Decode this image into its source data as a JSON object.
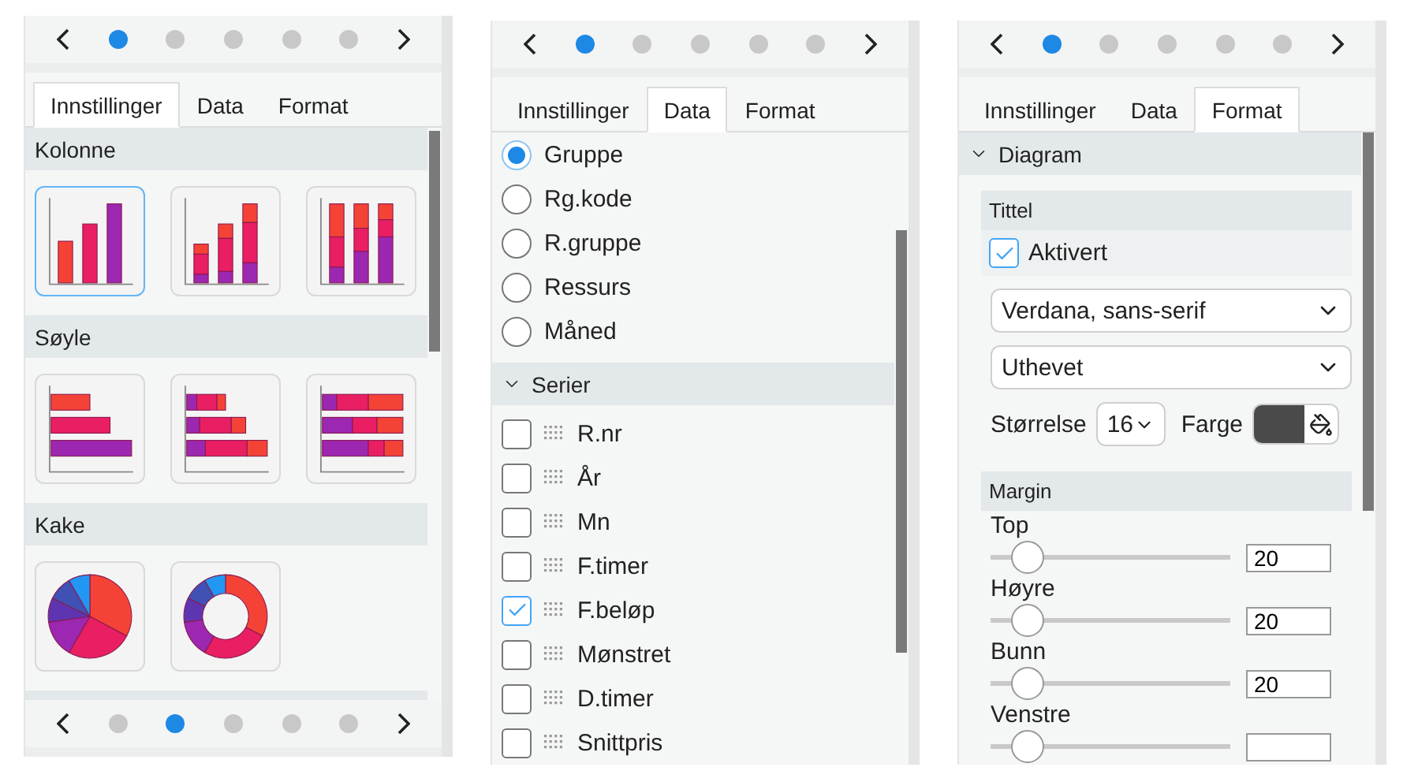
{
  "panels": [
    {
      "kind": "chart-types",
      "pager": [
        {
          "selected": true
        },
        {
          "selected": false
        },
        {
          "selected": false
        },
        {
          "selected": false
        },
        {
          "selected": false
        }
      ],
      "tabs": [
        {
          "label": "Innstillinger",
          "selected": true
        },
        {
          "label": "Data",
          "selected": false
        },
        {
          "label": "Format",
          "selected": false
        }
      ],
      "sections": [
        {
          "title": "Kolonne",
          "charts": [
            {
              "kind": "column",
              "selected": true
            },
            {
              "kind": "column-stacked",
              "selected": false
            },
            {
              "kind": "column-full",
              "selected": false
            }
          ]
        },
        {
          "title": "Søyle",
          "charts": [
            {
              "kind": "bar",
              "selected": false
            },
            {
              "kind": "bar-stacked",
              "selected": false
            },
            {
              "kind": "bar-full",
              "selected": false
            }
          ]
        },
        {
          "title": "Kake",
          "charts": [
            {
              "kind": "pie",
              "selected": false
            },
            {
              "kind": "donut",
              "selected": false
            }
          ]
        }
      ],
      "bottom_pager": [
        {
          "selected": false
        },
        {
          "selected": true
        },
        {
          "selected": false
        },
        {
          "selected": false
        },
        {
          "selected": false
        }
      ]
    },
    {
      "kind": "data",
      "pager": [
        {
          "selected": true
        },
        {
          "selected": false
        },
        {
          "selected": false
        },
        {
          "selected": false
        },
        {
          "selected": false
        }
      ],
      "tabs": [
        {
          "label": "Innstillinger",
          "selected": false
        },
        {
          "label": "Data",
          "selected": true
        },
        {
          "label": "Format",
          "selected": false
        }
      ],
      "groupings": [
        {
          "label": "Gruppe",
          "selected": true
        },
        {
          "label": "Rg.kode",
          "selected": false
        },
        {
          "label": "R.gruppe",
          "selected": false
        },
        {
          "label": "Ressurs",
          "selected": false
        },
        {
          "label": "Måned",
          "selected": false
        }
      ],
      "series_section": {
        "title": "Serier",
        "expanded": true,
        "items": [
          {
            "label": "R.nr",
            "checked": false
          },
          {
            "label": "År",
            "checked": false
          },
          {
            "label": "Mn",
            "checked": false
          },
          {
            "label": "F.timer",
            "checked": false
          },
          {
            "label": "F.beløp",
            "checked": true
          },
          {
            "label": "Mønstret",
            "checked": false
          },
          {
            "label": "D.timer",
            "checked": false
          },
          {
            "label": "Snittpris",
            "checked": false
          }
        ]
      }
    },
    {
      "kind": "format",
      "pager": [
        {
          "selected": true
        },
        {
          "selected": false
        },
        {
          "selected": false
        },
        {
          "selected": false
        },
        {
          "selected": false
        }
      ],
      "tabs": [
        {
          "label": "Innstillinger",
          "selected": false
        },
        {
          "label": "Data",
          "selected": false
        },
        {
          "label": "Format",
          "selected": true
        }
      ],
      "section": {
        "title": "Diagram",
        "expanded": true,
        "title_group": {
          "heading": "Tittel",
          "enabled": {
            "label": "Aktivert",
            "checked": true
          },
          "font": "Verdana, sans-serif",
          "weight": "Uthevet",
          "size_label": "Størrelse",
          "size": "16",
          "color_label": "Farge",
          "color": "#4a4a4a"
        },
        "margin_group": {
          "heading": "Margin",
          "fields": [
            {
              "label": "Top",
              "level": 0.1,
              "value": "20"
            },
            {
              "label": "Høyre",
              "level": 0.1,
              "value": "20"
            },
            {
              "label": "Bunn",
              "level": 0.1,
              "value": "20"
            },
            {
              "label": "Venstre",
              "level": 0.1
            }
          ]
        }
      }
    }
  ]
}
